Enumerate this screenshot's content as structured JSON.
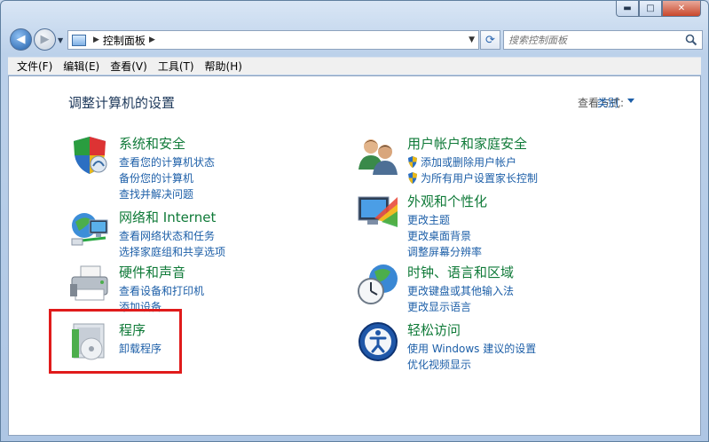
{
  "window": {
    "caption_min": "▬",
    "caption_max": "□",
    "caption_close": "✕"
  },
  "address": {
    "crumb": "控制面板"
  },
  "search": {
    "placeholder": "搜索控制面板"
  },
  "menu": [
    "文件(F)",
    "编辑(E)",
    "查看(V)",
    "工具(T)",
    "帮助(H)"
  ],
  "page": {
    "title": "调整计算机的设置",
    "view_by_label": "查看方式:",
    "view_by_value": "类别"
  },
  "categories": [
    {
      "title": "系统和安全",
      "icon": "shield-icon",
      "links": [
        "查看您的计算机状态",
        "备份您的计算机",
        "查找并解决问题"
      ]
    },
    {
      "title": "网络和 Internet",
      "icon": "network-globe-icon",
      "links": [
        "查看网络状态和任务",
        "选择家庭组和共享选项"
      ]
    },
    {
      "title": "硬件和声音",
      "icon": "printer-icon",
      "links": [
        "查看设备和打印机",
        "添加设备"
      ]
    },
    {
      "title": "程序",
      "icon": "programs-icon",
      "links": [
        "卸载程序"
      ]
    },
    {
      "title": "用户帐户和家庭安全",
      "icon": "users-icon",
      "links": [
        "添加或删除用户帐户",
        "为所有用户设置家长控制"
      ]
    },
    {
      "title": "外观和个性化",
      "icon": "display-icon",
      "links": [
        "更改主题",
        "更改桌面背景",
        "调整屏幕分辨率"
      ]
    },
    {
      "title": "时钟、语言和区域",
      "icon": "clock-globe-icon",
      "links": [
        "更改键盘或其他输入法",
        "更改显示语言"
      ]
    },
    {
      "title": "轻松访问",
      "icon": "ease-of-access-icon",
      "links": [
        "使用 Windows 建议的设置",
        "优化视频显示"
      ]
    }
  ],
  "colors": {
    "category_title": "#0f7a38",
    "link": "#1d5fa8",
    "highlight": "#e01b1b"
  }
}
